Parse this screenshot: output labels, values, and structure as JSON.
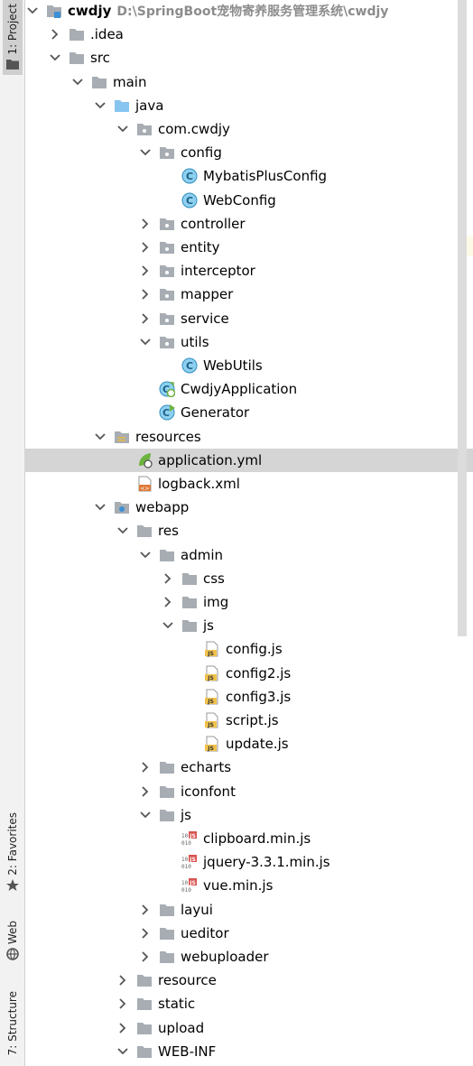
{
  "side_tabs": [
    {
      "id": "project",
      "label": "1: Project",
      "icon": "folder-icon"
    },
    {
      "id": "favorites",
      "label": "2: Favorites",
      "icon": "star-icon"
    },
    {
      "id": "web",
      "label": "Web",
      "icon": "web-icon"
    },
    {
      "id": "structure",
      "label": "7: Structure",
      "icon": "structure-icon"
    }
  ],
  "tree": [
    {
      "depth": 0,
      "label": "cwdjy",
      "hint": "D:\\SpringBoot宠物寄养服务管理系统\\cwdjy",
      "arrow": "open",
      "icon": "module-folder",
      "bold": true
    },
    {
      "depth": 1,
      "label": ".idea",
      "arrow": "closed",
      "icon": "folder"
    },
    {
      "depth": 1,
      "label": "src",
      "arrow": "open",
      "icon": "folder"
    },
    {
      "depth": 2,
      "label": "main",
      "arrow": "open",
      "icon": "folder"
    },
    {
      "depth": 3,
      "label": "java",
      "arrow": "open",
      "icon": "source-folder"
    },
    {
      "depth": 4,
      "label": "com.cwdjy",
      "arrow": "open",
      "icon": "package"
    },
    {
      "depth": 5,
      "label": "config",
      "arrow": "open",
      "icon": "package"
    },
    {
      "depth": 6,
      "label": "MybatisPlusConfig",
      "arrow": "none",
      "icon": "class"
    },
    {
      "depth": 6,
      "label": "WebConfig",
      "arrow": "none",
      "icon": "class"
    },
    {
      "depth": 5,
      "label": "controller",
      "arrow": "closed",
      "icon": "package"
    },
    {
      "depth": 5,
      "label": "entity",
      "arrow": "closed",
      "icon": "package"
    },
    {
      "depth": 5,
      "label": "interceptor",
      "arrow": "closed",
      "icon": "package"
    },
    {
      "depth": 5,
      "label": "mapper",
      "arrow": "closed",
      "icon": "package"
    },
    {
      "depth": 5,
      "label": "service",
      "arrow": "closed",
      "icon": "package"
    },
    {
      "depth": 5,
      "label": "utils",
      "arrow": "open",
      "icon": "package"
    },
    {
      "depth": 6,
      "label": "WebUtils",
      "arrow": "none",
      "icon": "class"
    },
    {
      "depth": 5,
      "label": "CwdjyApplication",
      "arrow": "none",
      "icon": "spring-class"
    },
    {
      "depth": 5,
      "label": "Generator",
      "arrow": "none",
      "icon": "main-class"
    },
    {
      "depth": 3,
      "label": "resources",
      "arrow": "open",
      "icon": "resources-folder"
    },
    {
      "depth": 4,
      "label": "application.yml",
      "arrow": "none",
      "icon": "yml-file",
      "selected": true
    },
    {
      "depth": 4,
      "label": "logback.xml",
      "arrow": "none",
      "icon": "xml-file"
    },
    {
      "depth": 3,
      "label": "webapp",
      "arrow": "open",
      "icon": "web-folder"
    },
    {
      "depth": 4,
      "label": "res",
      "arrow": "open",
      "icon": "folder"
    },
    {
      "depth": 5,
      "label": "admin",
      "arrow": "open",
      "icon": "folder"
    },
    {
      "depth": 6,
      "label": "css",
      "arrow": "closed",
      "icon": "folder"
    },
    {
      "depth": 6,
      "label": "img",
      "arrow": "closed",
      "icon": "folder"
    },
    {
      "depth": 6,
      "label": "js",
      "arrow": "open",
      "icon": "folder"
    },
    {
      "depth": 7,
      "label": "config.js",
      "arrow": "none",
      "icon": "js-file"
    },
    {
      "depth": 7,
      "label": "config2.js",
      "arrow": "none",
      "icon": "js-file"
    },
    {
      "depth": 7,
      "label": "config3.js",
      "arrow": "none",
      "icon": "js-file"
    },
    {
      "depth": 7,
      "label": "script.js",
      "arrow": "none",
      "icon": "js-file"
    },
    {
      "depth": 7,
      "label": "update.js",
      "arrow": "none",
      "icon": "js-file"
    },
    {
      "depth": 5,
      "label": "echarts",
      "arrow": "closed",
      "icon": "folder"
    },
    {
      "depth": 5,
      "label": "iconfont",
      "arrow": "closed",
      "icon": "folder"
    },
    {
      "depth": 5,
      "label": "js",
      "arrow": "open",
      "icon": "folder"
    },
    {
      "depth": 6,
      "label": "clipboard.min.js",
      "arrow": "none",
      "icon": "min-js-file"
    },
    {
      "depth": 6,
      "label": "jquery-3.3.1.min.js",
      "arrow": "none",
      "icon": "min-js-file"
    },
    {
      "depth": 6,
      "label": "vue.min.js",
      "arrow": "none",
      "icon": "min-js-file"
    },
    {
      "depth": 5,
      "label": "layui",
      "arrow": "closed",
      "icon": "folder"
    },
    {
      "depth": 5,
      "label": "ueditor",
      "arrow": "closed",
      "icon": "folder"
    },
    {
      "depth": 5,
      "label": "webuploader",
      "arrow": "closed",
      "icon": "folder"
    },
    {
      "depth": 4,
      "label": "resource",
      "arrow": "closed",
      "icon": "folder"
    },
    {
      "depth": 4,
      "label": "static",
      "arrow": "closed",
      "icon": "folder"
    },
    {
      "depth": 4,
      "label": "upload",
      "arrow": "closed",
      "icon": "folder"
    },
    {
      "depth": 4,
      "label": "WEB-INF",
      "arrow": "open",
      "icon": "folder"
    }
  ],
  "colors": {
    "folder": "#a7adb3",
    "source_folder": "#87c4ef",
    "class_circle": "#8ed0f0",
    "class_border": "#2f8ec0",
    "spring": "#6db33f",
    "js_yellow": "#f0c24b",
    "xml_orange": "#e07b39",
    "selected_row": "#d5d5d5"
  }
}
